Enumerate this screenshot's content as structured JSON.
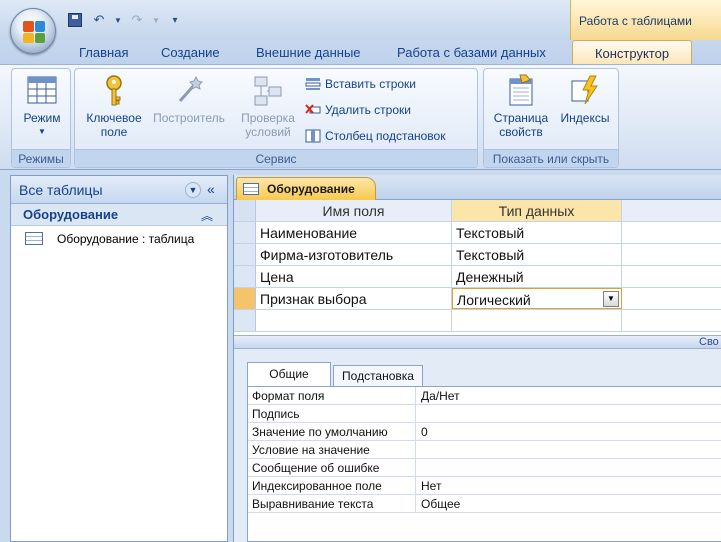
{
  "titlebar": {
    "quick_access": {
      "undo_icon": "undo-icon",
      "redo_icon": "redo-icon",
      "save_icon": "save-icon"
    },
    "contextual_group": "Работа с таблицами"
  },
  "tabs": [
    {
      "label": "Главная"
    },
    {
      "label": "Создание"
    },
    {
      "label": "Внешние данные"
    },
    {
      "label": "Работа с базами данных"
    },
    {
      "label": "Конструктор",
      "active": true
    }
  ],
  "ribbon": {
    "groups": {
      "views": {
        "label": "Режимы",
        "view_button": "Режим"
      },
      "tools": {
        "label": "Сервис",
        "primary_key": {
          "line1": "Ключевое",
          "line2": "поле"
        },
        "builder": "Построитель",
        "test_rules": {
          "line1": "Проверка",
          "line2": "условий"
        },
        "insert_rows": "Вставить строки",
        "delete_rows": "Удалить строки",
        "lookup_column": "Столбец подстановок"
      },
      "show_hide": {
        "label": "Показать или скрыть",
        "property_sheet": {
          "line1": "Страница",
          "line2": "свойств"
        },
        "indexes": "Индексы"
      }
    }
  },
  "nav_pane": {
    "title": "Все таблицы",
    "group": "Оборудование",
    "items": [
      {
        "label": "Оборудование : таблица"
      }
    ]
  },
  "document": {
    "tab_label": "Оборудование",
    "grid": {
      "headers": {
        "field_name": "Имя поля",
        "data_type": "Тип данных"
      },
      "rows": [
        {
          "field": "Наименование",
          "type": "Текстовый"
        },
        {
          "field": "Фирма-изготовитель",
          "type": "Текстовый"
        },
        {
          "field": "Цена",
          "type": "Денежный"
        },
        {
          "field": "Признак выбора",
          "type": "Логический"
        }
      ]
    },
    "props_bar_label": "Сво",
    "properties": {
      "tabs": {
        "general": "Общие",
        "lookup": "Подстановка"
      },
      "rows": [
        {
          "label": "Формат поля",
          "value": "Да/Нет"
        },
        {
          "label": "Подпись",
          "value": ""
        },
        {
          "label": "Значение по умолчанию",
          "value": "0"
        },
        {
          "label": "Условие на значение",
          "value": ""
        },
        {
          "label": "Сообщение об ошибке",
          "value": ""
        },
        {
          "label": "Индексированное поле",
          "value": "Нет"
        },
        {
          "label": "Выравнивание текста",
          "value": "Общее"
        }
      ]
    }
  },
  "colors": {
    "accent": "#f7c94f",
    "ribbon_text": "#15428b",
    "office_orange": "#e46c0a"
  }
}
